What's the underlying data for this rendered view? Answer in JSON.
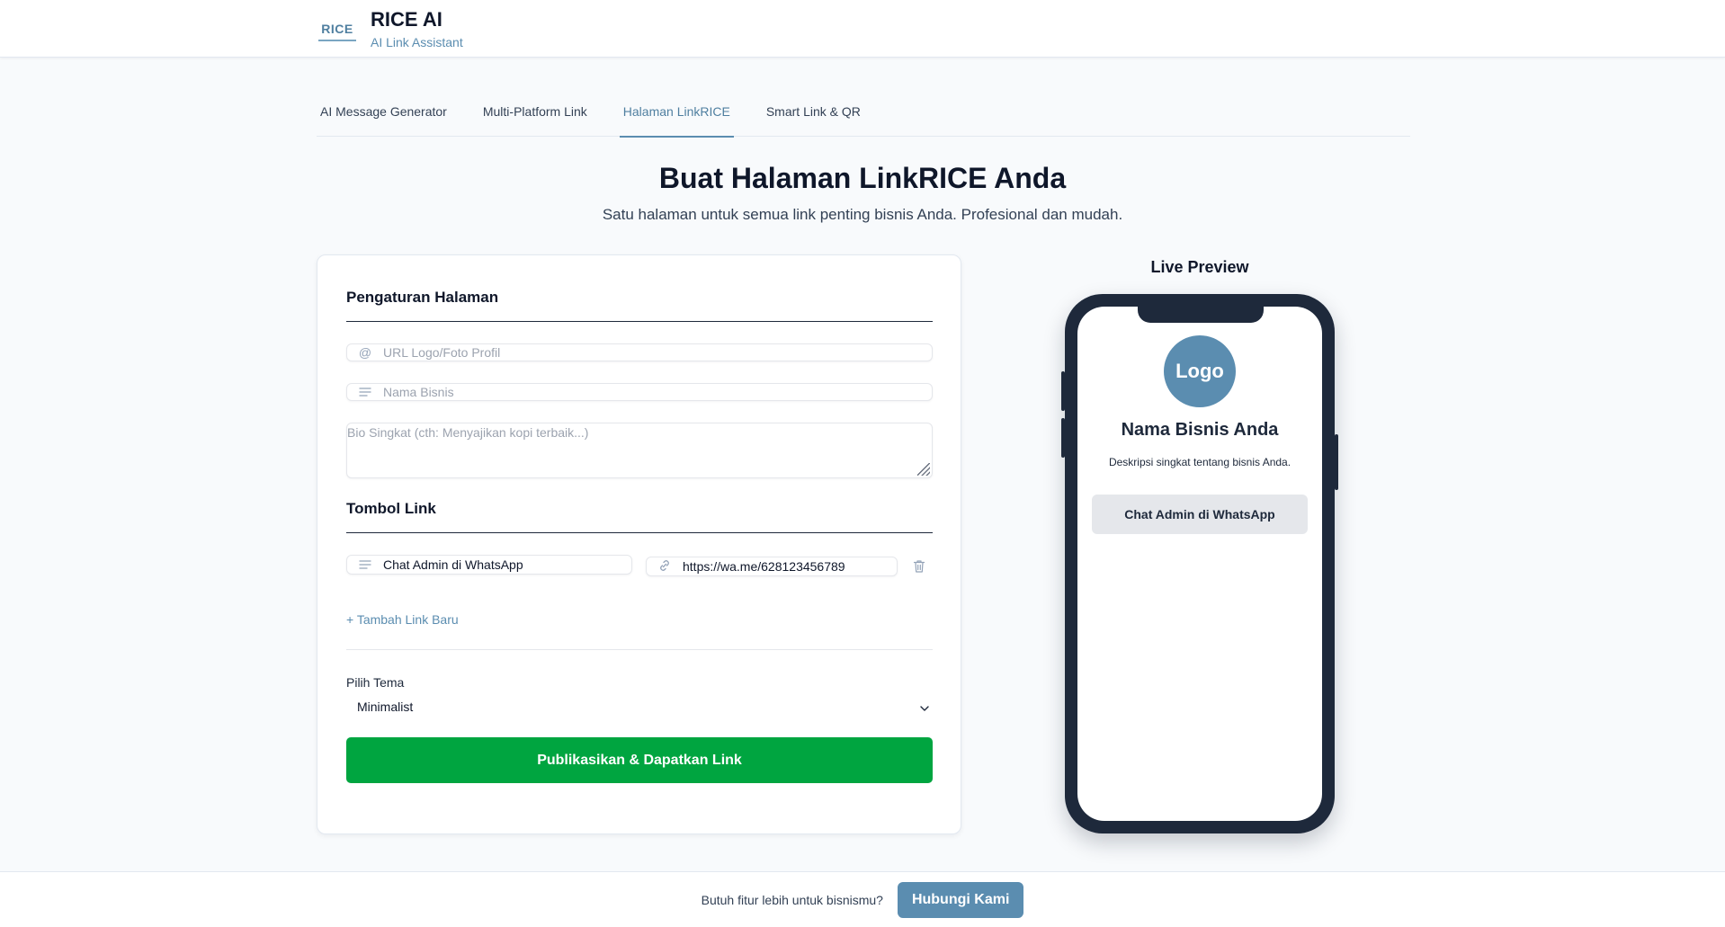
{
  "header": {
    "logo_text": "RICE",
    "title": "RICE AI",
    "subtitle": "AI Link Assistant"
  },
  "tabs": [
    {
      "label": "AI Message Generator",
      "active": false
    },
    {
      "label": "Multi-Platform Link",
      "active": false
    },
    {
      "label": "Halaman LinkRICE",
      "active": true
    },
    {
      "label": "Smart Link & QR",
      "active": false
    }
  ],
  "page": {
    "title": "Buat Halaman LinkRICE Anda",
    "subtitle": "Satu halaman untuk semua link penting bisnis Anda. Profesional dan mudah."
  },
  "settings": {
    "section_title": "Pengaturan Halaman",
    "logo_url_placeholder": "URL Logo/Foto Profil",
    "business_name_placeholder": "Nama Bisnis",
    "bio_placeholder": "Bio Singkat (cth: Menyajikan kopi terbaik...)",
    "links_title": "Tombol Link",
    "links": [
      {
        "label": "Chat Admin di WhatsApp",
        "url": "https://wa.me/628123456789"
      }
    ],
    "add_link_label": "+ Tambah Link Baru",
    "theme_label": "Pilih Tema",
    "theme_value": "Minimalist",
    "publish_label": "Publikasikan & Dapatkan Link"
  },
  "preview": {
    "title": "Live Preview",
    "logo_text": "Logo",
    "business_name": "Nama Bisnis Anda",
    "description": "Deskripsi singkat tentang bisnis Anda.",
    "link_label": "Chat Admin di WhatsApp"
  },
  "footer": {
    "text": "Butuh fitur lebih untuk bisnismu?",
    "button_label": "Hubungi Kami"
  },
  "colors": {
    "accent": "#5b8db0",
    "publish_green": "#00a540",
    "phone_frame": "#1e293b"
  }
}
